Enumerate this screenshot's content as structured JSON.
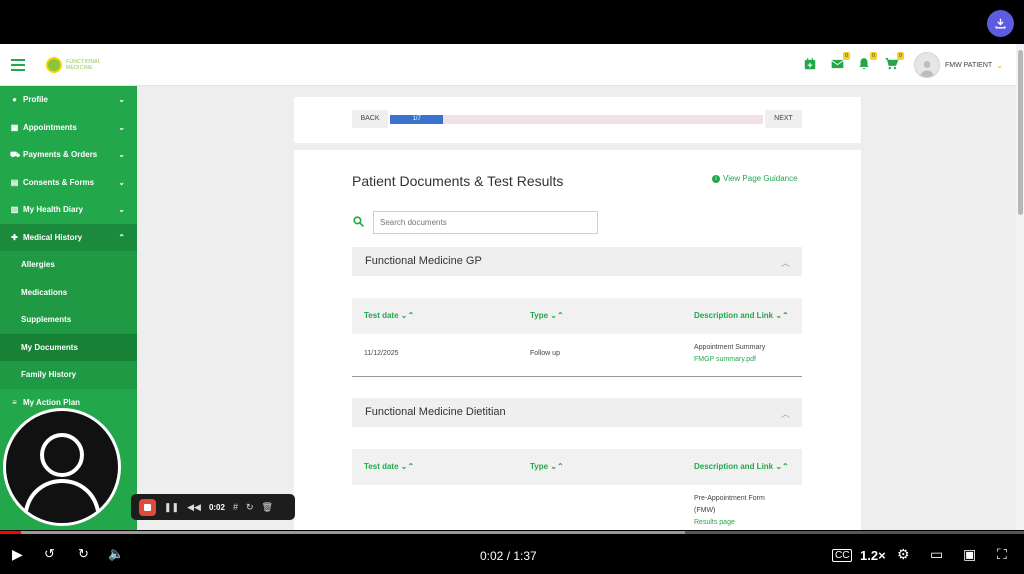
{
  "header": {
    "logo_text": "FUNCTIONAL MEDICINE",
    "user_name": "FMW PATIENT",
    "badges": {
      "messages": "0",
      "notifications": "0",
      "cart": "0"
    }
  },
  "sidebar": {
    "items": [
      {
        "label": "Profile",
        "icon": "person-icon"
      },
      {
        "label": "Appointments",
        "icon": "calendar-icon"
      },
      {
        "label": "Payments & Orders",
        "icon": "cart-icon"
      },
      {
        "label": "Consents & Forms",
        "icon": "document-icon"
      },
      {
        "label": "My Health Diary",
        "icon": "book-icon"
      },
      {
        "label": "Medical History",
        "icon": "medical-icon"
      }
    ],
    "sub_items": [
      "Allergies",
      "Medications",
      "Supplements",
      "My Documents",
      "Family History"
    ],
    "action_plan": "My Action Plan"
  },
  "wizard": {
    "back_label": "BACK",
    "next_label": "NEXT",
    "progress_label": "1/7",
    "progress_fraction": 0.1428
  },
  "page": {
    "title": "Patient Documents & Test Results",
    "guidance_label": "View Page Guidance",
    "search_placeholder": "Search documents"
  },
  "sections": [
    {
      "title": "Functional Medicine GP",
      "columns": [
        "Test date",
        "Type",
        "Description and Link"
      ],
      "rows": [
        {
          "date": "11/12/2025",
          "type": "Follow up",
          "description": "Appointment Summary",
          "link": "FMGP summary.pdf"
        }
      ]
    },
    {
      "title": "Functional Medicine Dietitian",
      "columns": [
        "Test date",
        "Type",
        "Description and Link"
      ],
      "rows": [
        {
          "date": "",
          "type": "",
          "description": "Pre-Appointment Form",
          "description2": "(FMW)",
          "link": "Results page"
        }
      ]
    }
  ],
  "recorder": {
    "time": "0:02"
  },
  "player": {
    "time": "0:02 / 1:37",
    "speed": "1.2×",
    "played_fraction": 0.0206,
    "buffered_fraction": 0.669
  },
  "colors": {
    "brand_green": "#23a74b",
    "progress_blue": "#3a72cc",
    "download_purple": "#5b5ce2",
    "youtube_red": "#ff0000"
  }
}
